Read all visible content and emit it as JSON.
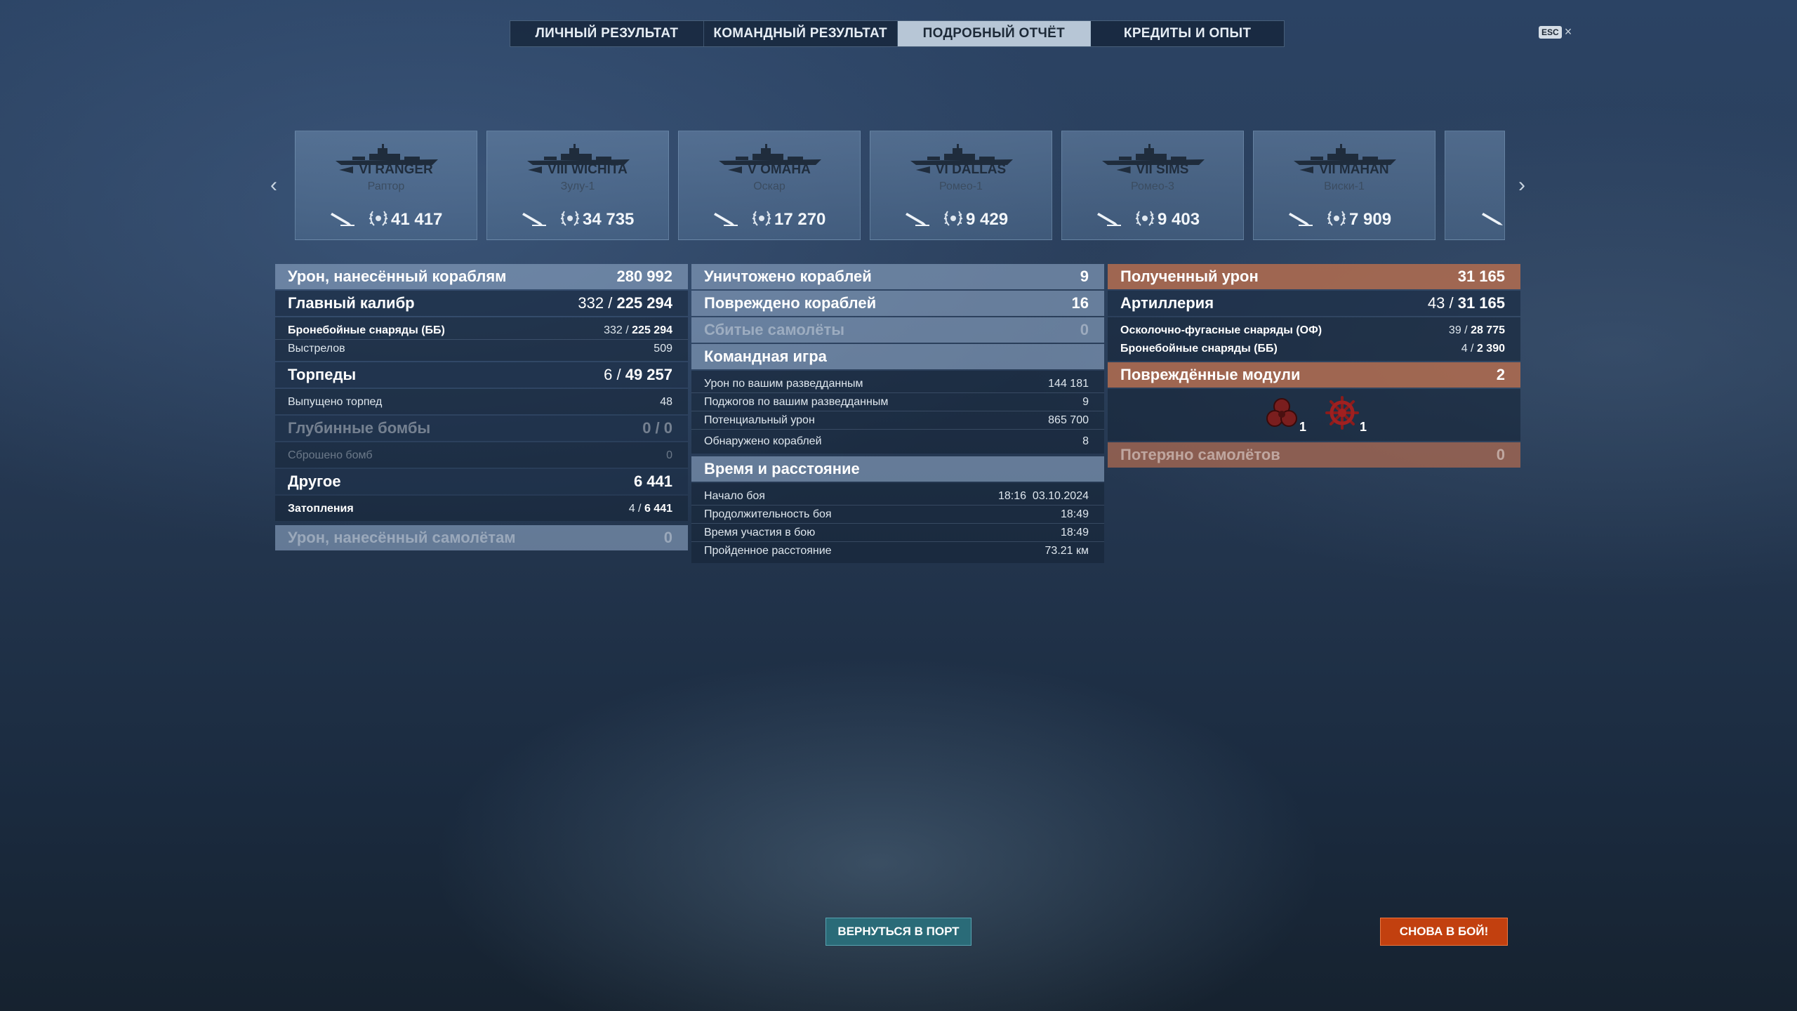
{
  "tabs": [
    {
      "label": "ЛИЧНЫЙ РЕЗУЛЬТАТ",
      "active": false
    },
    {
      "label": "КОМАНДНЫЙ РЕЗУЛЬТАТ",
      "active": false
    },
    {
      "label": "ПОДРОБНЫЙ ОТЧЁТ",
      "active": true
    },
    {
      "label": "КРЕДИТЫ И ОПЫТ",
      "active": false
    }
  ],
  "close": {
    "key": "ESC",
    "icon": "×"
  },
  "ships": [
    {
      "name": "VI RANGER",
      "code": "Раптор",
      "value": "41 417"
    },
    {
      "name": "VIII WICHITA",
      "code": "Зулу-1",
      "value": "34 735"
    },
    {
      "name": "V OMAHA",
      "code": "Оскар",
      "value": "17 270"
    },
    {
      "name": "VI DALLAS",
      "code": "Ромео-1",
      "value": "9 429"
    },
    {
      "name": "VII SIMS",
      "code": "Ромео-3",
      "value": "9 403"
    },
    {
      "name": "VII MAHAN",
      "code": "Виски-1",
      "value": "7 909"
    }
  ],
  "left": {
    "header": {
      "label": "Урон, нанесённый кораблям",
      "value": "280 992"
    },
    "main_caliber": {
      "label": "Главный калибр",
      "hits": "332",
      "value": "225 294"
    },
    "ap_shells": {
      "label": "Бронебойные снаряды (ББ)",
      "hits": "332",
      "value": "225 294"
    },
    "shots": {
      "label": "Выстрелов",
      "value": "509"
    },
    "torpedoes": {
      "label": "Торпеды",
      "hits": "6",
      "value": "49 257"
    },
    "torpedoes_fired": {
      "label": "Выпущено торпед",
      "value": "48"
    },
    "depth_charges": {
      "label": "Глубинные бомбы",
      "value": "0 / 0"
    },
    "bombs_dropped": {
      "label": "Сброшено бомб",
      "value": "0"
    },
    "other": {
      "label": "Другое",
      "value": "6 441"
    },
    "flooding": {
      "label": "Затопления",
      "hits": "4",
      "value": "6 441"
    },
    "aircraft_damage": {
      "label": "Урон, нанесённый самолётам",
      "value": "0"
    }
  },
  "middle": {
    "destroyed": {
      "label": "Уничтожено кораблей",
      "value": "9"
    },
    "damaged": {
      "label": "Повреждено кораблей",
      "value": "16"
    },
    "planes": {
      "label": "Сбитые самолёты",
      "value": "0"
    },
    "team_header": "Командная игра",
    "team_rows": [
      {
        "label": "Урон по вашим разведданным",
        "value": "144 181"
      },
      {
        "label": "Поджогов по вашим разведданным",
        "value": "9"
      },
      {
        "label": "Потенциальный урон",
        "value": "865 700"
      },
      {
        "label": "Обнаружено кораблей",
        "value": "8"
      }
    ],
    "time_header": "Время и расстояние",
    "time_rows": [
      {
        "label": "Начало боя",
        "value": "18:16  03.10.2024"
      },
      {
        "label": "Продолжительность боя",
        "value": "18:49"
      },
      {
        "label": "Время участия в бою",
        "value": "18:49"
      },
      {
        "label": "Пройденное расстояние",
        "value": "73.21 км"
      }
    ]
  },
  "right": {
    "received": {
      "label": "Полученный урон",
      "value": "31 165"
    },
    "artillery": {
      "label": "Артиллерия",
      "hits": "43",
      "value": "31 165"
    },
    "he_shells": {
      "label": "Осколочно-фугасные снаряды (ОФ)",
      "hits": "39",
      "value": "28 775"
    },
    "ap_shells": {
      "label": "Бронебойные снаряды (ББ)",
      "hits": "4",
      "value": "2 390"
    },
    "modules_header": {
      "label": "Повреждённые модули",
      "value": "2"
    },
    "modules": [
      {
        "icon": "engine-module-icon",
        "count": "1"
      },
      {
        "icon": "steering-module-icon",
        "count": "1"
      }
    ],
    "planes_lost": {
      "label": "Потеряно самолётов",
      "value": "0"
    }
  },
  "buttons": {
    "port": "ВЕРНУТЬСЯ В ПОРТ",
    "battle": "СНОВА В БОЙ!"
  }
}
